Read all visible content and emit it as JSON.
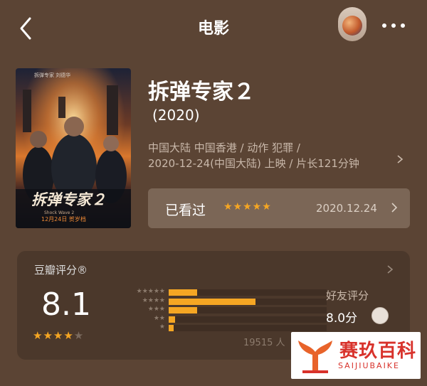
{
  "header": {
    "title": "电影"
  },
  "movie": {
    "title": "拆弹专家２",
    "year": "(2020)",
    "meta_line1": "中国大陆 中国香港 / 动作 犯罪 /",
    "meta_line2": "2020-12-24(中国大陆) 上映 / 片长121分钟",
    "poster_top_text": "拆弹专家  刘德华",
    "poster_title": "拆弹专家２",
    "poster_date": "12月24日 贺岁档",
    "poster_tagline": "Shock Wave 2"
  },
  "watched": {
    "label": "已看过",
    "stars": "★★★★★",
    "date": "2020.12.24"
  },
  "rating": {
    "label": "豆瓣评分®",
    "score": "8.1",
    "stars_filled": "★★★★",
    "stars_empty": "★",
    "distribution": [
      {
        "stars": "★★★★★",
        "percent": 0.18
      },
      {
        "stars": "★★★★",
        "percent": 0.55
      },
      {
        "stars": "★★★",
        "percent": 0.18
      },
      {
        "stars": "★★",
        "percent": 0.04
      },
      {
        "stars": "★",
        "percent": 0.03
      }
    ],
    "count": "19515 人",
    "friend_label": "好友评分",
    "friend_score": "8.0分"
  },
  "watermark": {
    "name": "赛玖百科",
    "sub": "SAIJIUBAIKE"
  },
  "colors": {
    "background": "#5b4434",
    "accent_star": "#f5a623",
    "watermark_red": "#d8322b"
  }
}
